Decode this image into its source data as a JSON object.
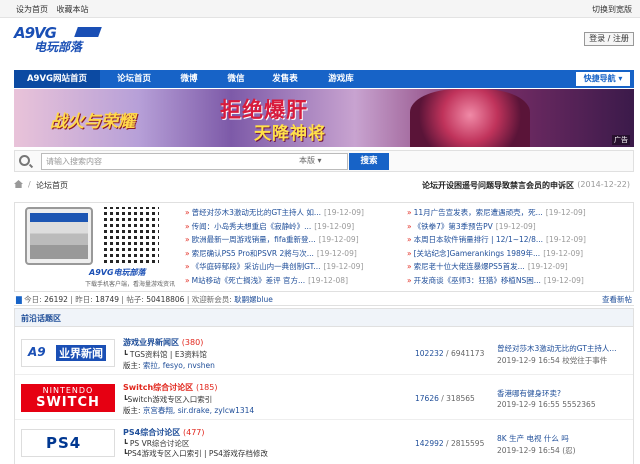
{
  "topbar": {
    "left": [
      "设为首页",
      "收藏本站"
    ],
    "right": "切换到宽版"
  },
  "logo": {
    "mark": "A9VG",
    "text": "电玩部落"
  },
  "header": {
    "login_label": "登录 / 注册"
  },
  "nav": {
    "items": [
      "A9VG网站首页",
      "论坛首页",
      "微博",
      "微信",
      "发售表",
      "游戏库"
    ],
    "quick_nav": "快捷导航"
  },
  "banner": {
    "title_left": "战火与荣耀",
    "headline": "拒绝爆肝",
    "subline": "天降神将",
    "ad_label": "广告"
  },
  "search": {
    "placeholder": "请输入搜索内容",
    "scope": "本版",
    "button": "搜索"
  },
  "breadcrumb": {
    "label": "论坛首页",
    "notice": "论坛开设困遥号问题导致禁言会员的申诉区",
    "notice_date": "(2014-12-22)"
  },
  "app": {
    "logo": "A9VG电玩部落",
    "sub": "下载手机客户端，看海量游戏资讯"
  },
  "news": {
    "left": [
      {
        "t": "曾经对莎木3激动无比的GT主持人 如...",
        "d": "[19-12-09]"
      },
      {
        "t": "传闻：小岛秀夫想重启《寂静岭》...",
        "d": "[19-12-09]"
      },
      {
        "t": "欧洲最新一周游戏销量，fifa重新登...",
        "d": "[19-12-09]"
      },
      {
        "t": "索尼确认PS5 Pro和PSVR 2將与次...",
        "d": "[19-12-09]"
      },
      {
        "t": "《华庭碎郁段》采访山内一典创制GT...",
        "d": "[19-12-09]"
      },
      {
        "t": "M站移动《死亡搁浅》差评 官方...",
        "d": "[19-12-08]"
      }
    ],
    "right": [
      {
        "t": "11月广告宣发表，索尼遭遇顽壳，死...",
        "d": "[19-12-09]"
      },
      {
        "t": "《铁拳7》第3季预告PV",
        "d": "[19-12-09]"
      },
      {
        "t": "本周日本软件销量排行 | 12/1~12/8...",
        "d": "[19-12-09]"
      },
      {
        "t": "[关站纪念]Gamerankings 1989年...",
        "d": "[19-12-09]"
      },
      {
        "t": "索尼老十位大佬连暴爆PS5首发...",
        "d": "[19-12-09]"
      },
      {
        "t": "开发商谈《巫师3：狂猎》移植NS困...",
        "d": "[19-12-09]"
      }
    ]
  },
  "stats": {
    "today_label": "今日:",
    "today": "26192",
    "yesterday_label": "昨日:",
    "yesterday": "18749",
    "posts_label": "帖子:",
    "posts": "50418806",
    "welcome_label": "欢迎新会员:",
    "newest": "耿嗣嫘blue",
    "view_new": "查看新帖"
  },
  "section": {
    "title": "前沿话题区",
    "forums": [
      {
        "name": "游戏业界新闻区",
        "count": "(380)",
        "sub": "┗ TGS资料馆 | E3资料馆",
        "mods_label": "版主:",
        "mods": "索拉, fesyo, nvshen",
        "threads": "102232",
        "posts": "6941173",
        "last_title": "曾经对莎木3激动无比的GT主持人...",
        "last_meta": "2019-12-9 16:54 校党往于事件"
      },
      {
        "name": "Switch综合讨论区",
        "count": "(185)",
        "sub": "┗Switch游戏专区入口索引",
        "mods_label": "版主:",
        "mods": "京宫春翔, sir.drake, zylcw1314",
        "threads": "17626",
        "posts": "318565",
        "last_title": "香港哪有健身环卖?",
        "last_meta": "2019-12-9 16:55 5552365"
      },
      {
        "name": "PS4综合讨论区",
        "count": "(477)",
        "sub": "┗ PS VR综合讨论区\n┗PS4游戏专区入口索引 | PS4游戏存档修改",
        "mods_label": "",
        "mods": "",
        "threads": "142992",
        "posts": "2815595",
        "last_title": "8K 生产 电视 什么 吗",
        "last_meta": "2019-12-9 16:54 (忍)"
      }
    ]
  },
  "badges": {
    "a9_news_a": "A9",
    "a9_news_b": "业界新闻",
    "ns_top": "NINTENDO",
    "ns_bottom": "SWITCH",
    "ps": "PS4"
  },
  "colors": {
    "brand": "#1763c7",
    "accent": "#e1251b",
    "link": "#1f4e99"
  }
}
